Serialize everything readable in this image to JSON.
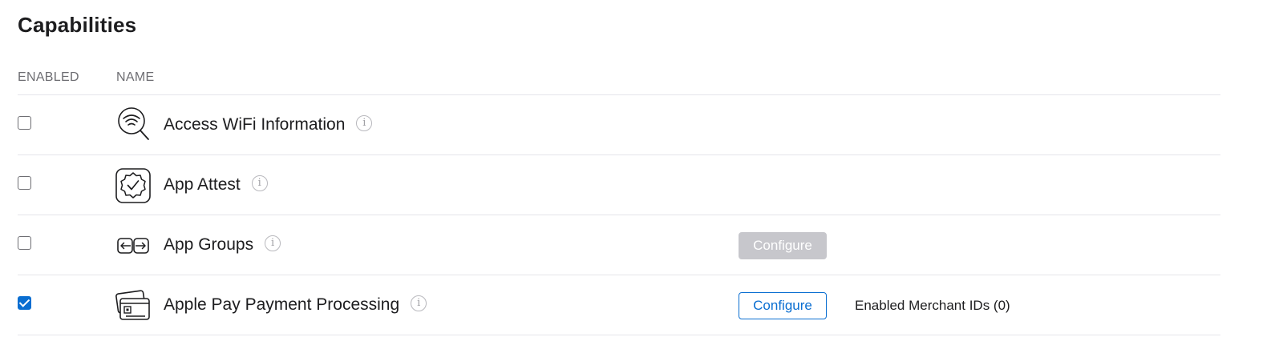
{
  "section": {
    "title": "Capabilities"
  },
  "table": {
    "headers": {
      "enabled": "ENABLED",
      "name": "NAME"
    },
    "rows": [
      {
        "name": "Access WiFi Information",
        "enabled": false,
        "icon": "wifi-search-icon",
        "info": "i"
      },
      {
        "name": "App Attest",
        "enabled": false,
        "icon": "badge-check-icon",
        "info": "i"
      },
      {
        "name": "App Groups",
        "enabled": false,
        "icon": "app-groups-arrows-icon",
        "info": "i",
        "configure_label": "Configure",
        "configure_enabled": false
      },
      {
        "name": "Apple Pay Payment Processing",
        "enabled": true,
        "icon": "payment-cards-icon",
        "info": "i",
        "configure_label": "Configure",
        "configure_enabled": true,
        "status": "Enabled Merchant IDs (0)"
      }
    ]
  },
  "colors": {
    "accent": "#0a6ed1",
    "disabled_button": "#c7c7cc",
    "divider": "#e5e5ea",
    "header_text": "#6e6e73"
  }
}
